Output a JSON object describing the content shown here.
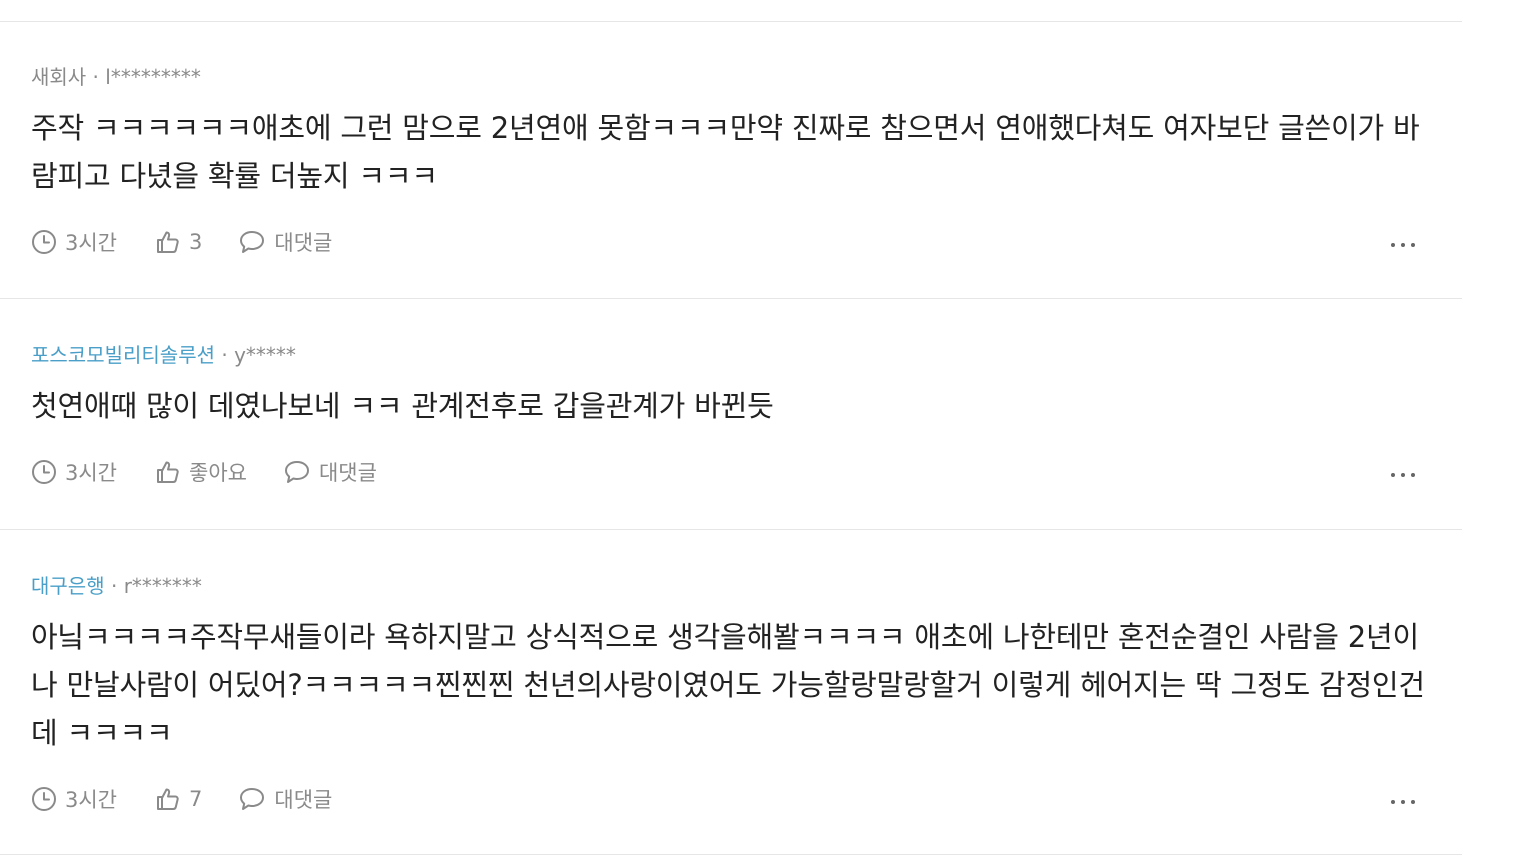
{
  "comments": [
    {
      "company": "새회사",
      "separator": " · ",
      "user": "l*********",
      "text": "주작 ㅋㅋㅋㅋㅋㅋ애초에 그런 맘으로 2년연애 못함ㅋㅋㅋ만약 진짜로 참으면서 연애했다쳐도 여자보단 글쓴이가 바람피고 다녔을 확률 더높지 ㅋㅋㅋ",
      "time": "3시간",
      "likes": "3",
      "reply_label": "대댓글"
    },
    {
      "company": "포스코모빌리티솔루션",
      "separator": " · ",
      "user": "y*****",
      "text": "첫연애때 많이 데였나보네 ㅋㅋ 관계전후로 갑을관계가 바뀐듯",
      "time": "3시간",
      "likes": "좋아요",
      "reply_label": "대댓글"
    },
    {
      "company": "대구은행",
      "separator": " · ",
      "user": "r*******",
      "text": "아닠ㅋㅋㅋㅋ주작무새들이라 욕하지말고 상식적으로 생각을해봘ㅋㅋㅋㅋ 애초에 나한테만 혼전순결인 사람을 2년이나 만날사람이 어딨어?ㅋㅋㅋㅋㅋ찐찐찐 천년의사랑이였어도 가능할랑말랑할거 이렇게 헤어지는 딱 그정도 감정인건데 ㅋㅋㅋㅋ",
      "time": "3시간",
      "likes": "7",
      "reply_label": "대댓글"
    }
  ],
  "icons": {
    "time": "clock-icon",
    "like": "thumbs-up-icon",
    "reply": "speech-bubble-icon",
    "more": "more-options-icon"
  },
  "colors": {
    "company_link": "#4a9fc8",
    "meta_gray": "#8a8a8a",
    "text": "#222222",
    "divider": "#e6e6e6"
  }
}
